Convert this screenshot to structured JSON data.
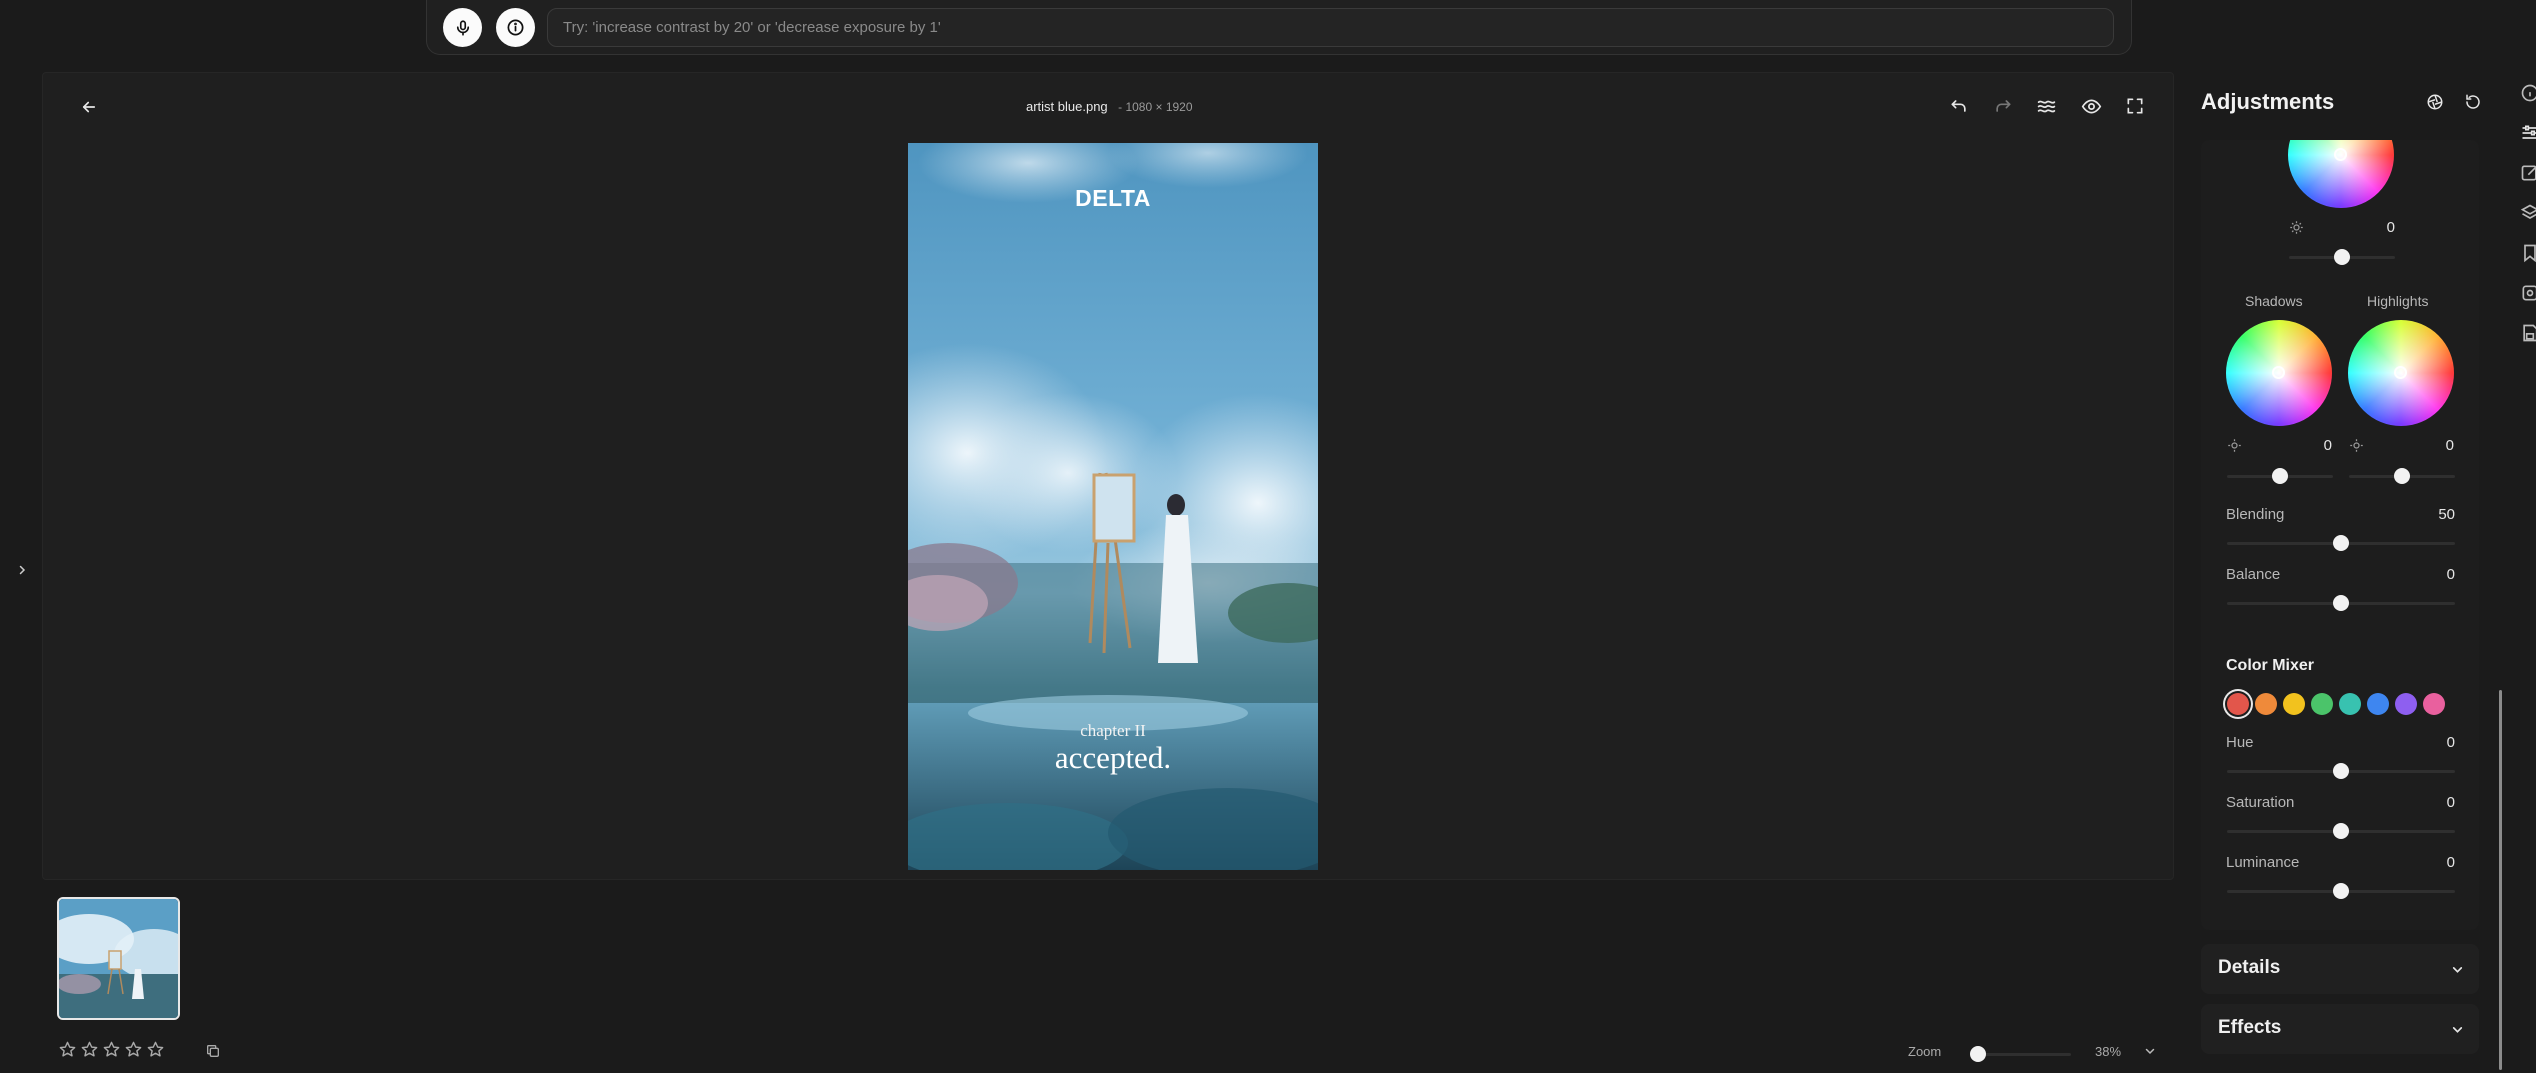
{
  "prompt_bar": {
    "placeholder": "Try: 'increase contrast by 20' or 'decrease exposure by 1'",
    "mic_icon": "microphone-icon",
    "info_icon": "info-icon"
  },
  "editor": {
    "file_name": "artist blue.png",
    "dimensions": "- 1080 × 1920",
    "toolbar_icons": [
      "back-arrow-icon",
      "undo-icon",
      "redo-icon",
      "waves-icon",
      "eye-icon",
      "fullscreen-icon"
    ]
  },
  "image": {
    "brand": "DELTA",
    "subtitle": "chapter II",
    "title": "accepted."
  },
  "filmstrip": {
    "rating_stars": 5,
    "rating_value": 0,
    "zoom_label": "Zoom",
    "zoom_value": "38%"
  },
  "panel": {
    "title": "Adjustments",
    "midtones_value": "0",
    "shadows_label": "Shadows",
    "highlights_label": "Highlights",
    "shadows_value": "0",
    "highlights_value": "0",
    "blending_label": "Blending",
    "blending_value": "50",
    "balance_label": "Balance",
    "balance_value": "0",
    "color_mixer_title": "Color Mixer",
    "swatches": [
      "#e2564b",
      "#ef8a3a",
      "#f2c21e",
      "#4bc46a",
      "#38c2b0",
      "#3e86f0",
      "#8e5ff0",
      "#e9609e"
    ],
    "hue_label": "Hue",
    "hue_value": "0",
    "saturation_label": "Saturation",
    "saturation_value": "0",
    "luminance_label": "Luminance",
    "luminance_value": "0",
    "details_label": "Details",
    "effects_label": "Effects"
  }
}
